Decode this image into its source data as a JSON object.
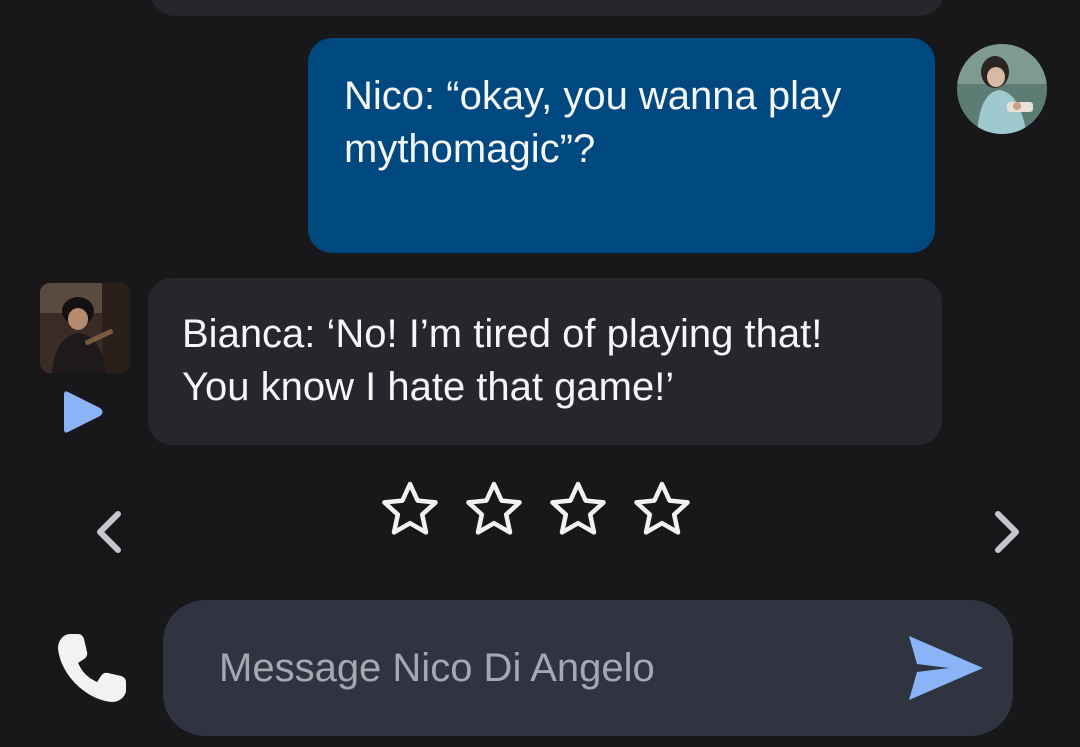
{
  "messages": [
    {
      "sender": "user",
      "text": "Nico: “okay, you wanna play\nmythomagic”?"
    },
    {
      "sender": "bot",
      "text": "Bianca: ‘No! I’m tired of playing that!\nYou know I hate that game!’"
    }
  ],
  "rating": {
    "max": 4,
    "value": 0
  },
  "composer": {
    "placeholder": "Message Nico Di Angelo",
    "value": ""
  },
  "icons": {
    "play": "play-icon",
    "star": "star-outline-icon",
    "prev": "chevron-left-icon",
    "next": "chevron-right-icon",
    "call": "phone-icon",
    "send": "send-icon"
  },
  "colors": {
    "background": "#18181b",
    "user_bubble": "#004880",
    "bot_bubble": "#26272b",
    "composer": "#2f3440",
    "accent": "#8ab4f8"
  }
}
